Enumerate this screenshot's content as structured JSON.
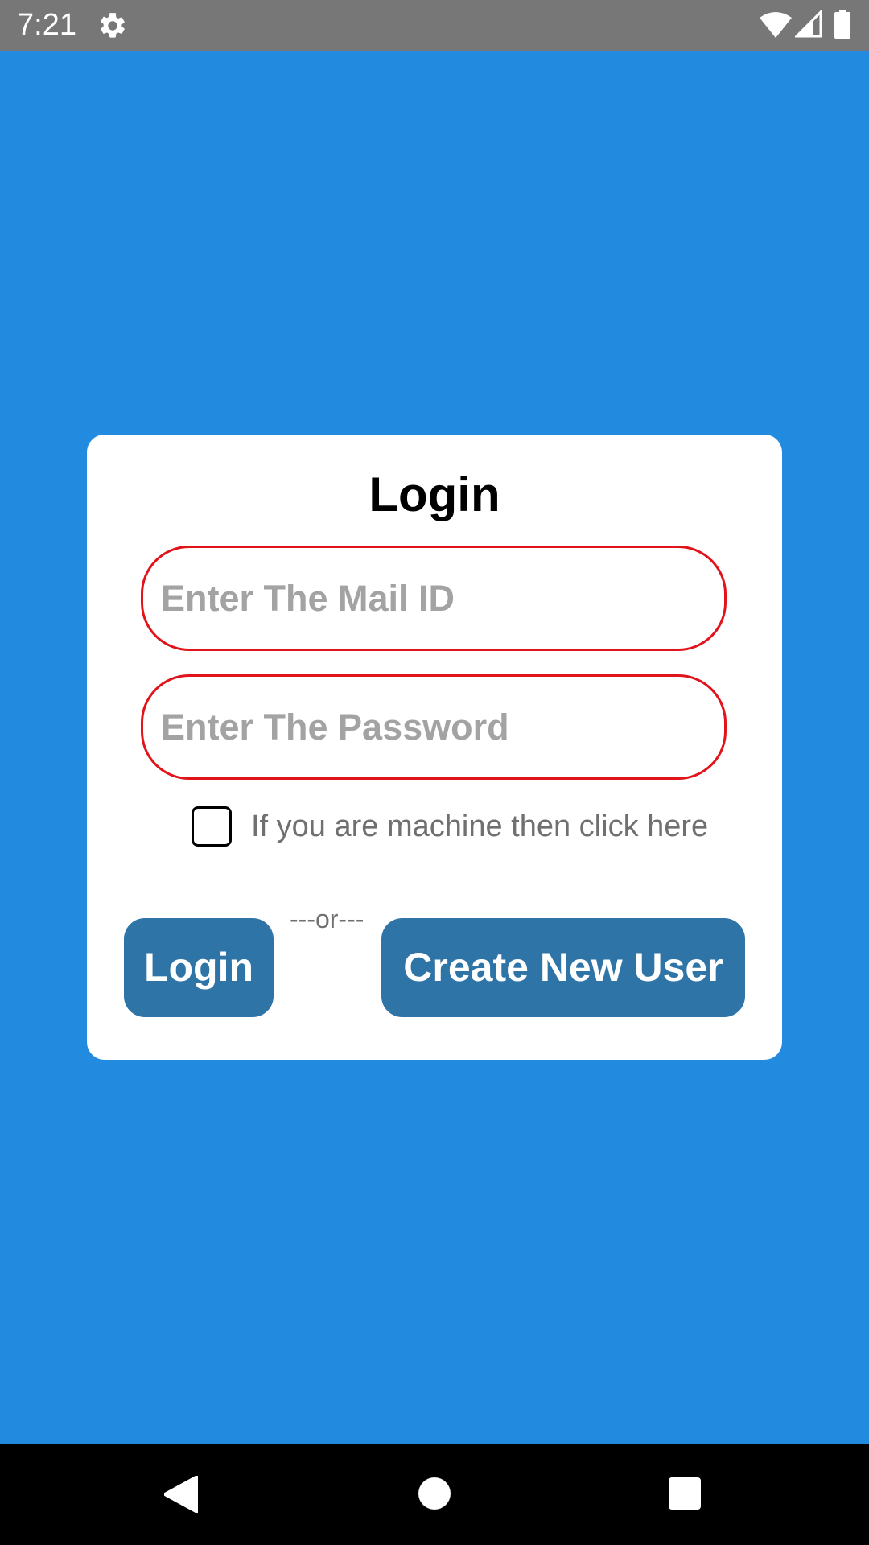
{
  "status_bar": {
    "time": "7:21",
    "icons": [
      "gear-icon",
      "wifi-icon",
      "signal-icon",
      "battery-icon"
    ]
  },
  "login_card": {
    "title": "Login",
    "email_placeholder": "Enter The Mail ID",
    "email_value": "",
    "password_placeholder": "Enter The Password",
    "password_value": "",
    "checkbox_label": "If you are machine then click here",
    "checkbox_checked": false,
    "separator": "---or---",
    "login_button": "Login",
    "create_user_button": "Create New User"
  },
  "nav_bar": {
    "icons": [
      "back-icon",
      "home-icon",
      "recents-icon"
    ]
  },
  "colors": {
    "background": "#228be0",
    "status_bar": "#777777",
    "button": "#2f74a6",
    "field_border": "#e0141a",
    "placeholder": "#a3a3a3",
    "secondary_text": "#707070"
  }
}
